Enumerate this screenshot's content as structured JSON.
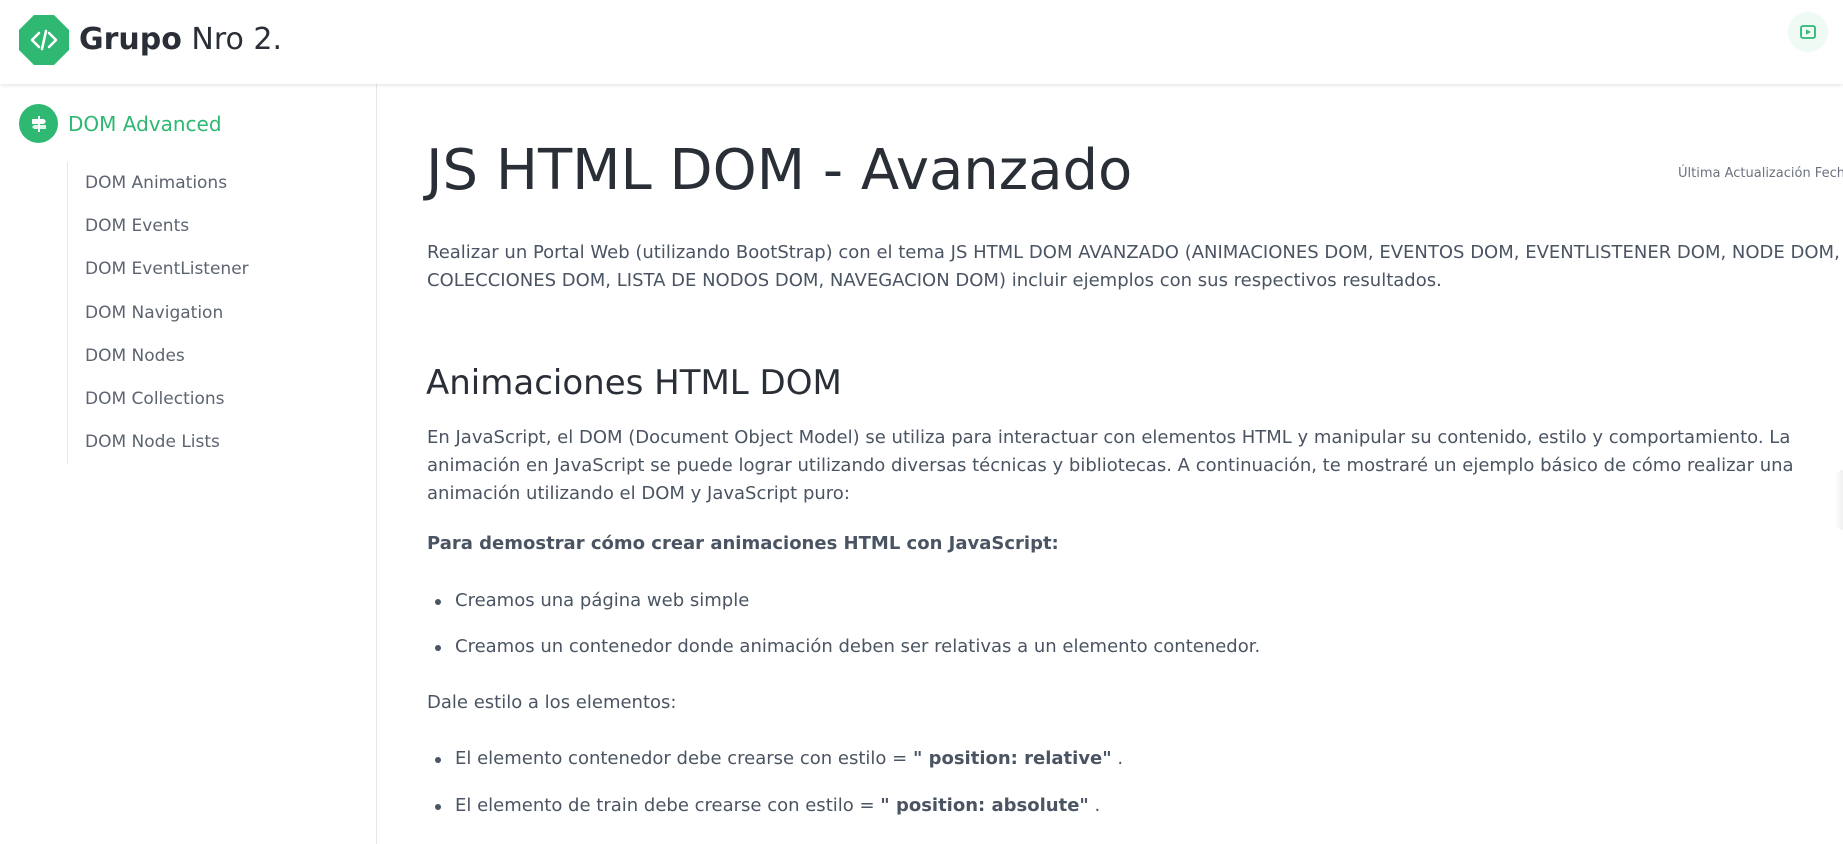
{
  "header": {
    "brand_strong": "Grupo",
    "brand_rest": "Nro 2.",
    "logo_icon": "code-icon",
    "right_icon": "youtube-icon",
    "accent": "#2eb872"
  },
  "sidebar": {
    "section_label": "DOM Advanced",
    "section_icon": "signpost-icon",
    "items": [
      {
        "label": "DOM Animations"
      },
      {
        "label": "DOM Events"
      },
      {
        "label": "DOM EventListener"
      },
      {
        "label": "DOM Navigation"
      },
      {
        "label": "DOM Nodes"
      },
      {
        "label": "DOM Collections"
      },
      {
        "label": "DOM Node Lists"
      }
    ]
  },
  "main": {
    "title": "JS HTML DOM - Avanzado",
    "last_update": "Última Actualización Fecha",
    "intro": "Realizar un Portal Web (utilizando BootStrap) con el tema JS HTML DOM AVANZADO (ANIMACIONES DOM, EVENTOS DOM, EVENTLISTENER DOM, NODE DOM, COLECCIONES DOM, LISTA DE NODOS DOM, NAVEGACION DOM) incluir ejemplos con sus respectivos resultados.",
    "section_title": "Animaciones HTML DOM",
    "paragraph": "En JavaScript, el DOM (Document Object Model) se utiliza para interactuar con elementos HTML y manipular su contenido, estilo y comportamiento. La animación en JavaScript se puede lograr utilizando diversas técnicas y bibliotecas. A continuación, te mostraré un ejemplo básico de cómo realizar una animación utilizando el DOM y JavaScript puro:",
    "bold_line": "Para demostrar cómo crear animaciones HTML con JavaScript:",
    "bullets_1": [
      "Creamos una página web simple",
      "Creamos un contenedor donde animación deben ser relativas a un elemento contenedor."
    ],
    "style_line": "Dale estilo a los elementos:",
    "bullets_2": [
      {
        "prefix": "El elemento contenedor debe crearse con estilo = ",
        "code": "\" position: relative\"",
        "suffix": " ."
      },
      {
        "prefix": "El elemento de train debe crearse con estilo = ",
        "code": "\" position: absolute\"",
        "suffix": " ."
      }
    ]
  }
}
